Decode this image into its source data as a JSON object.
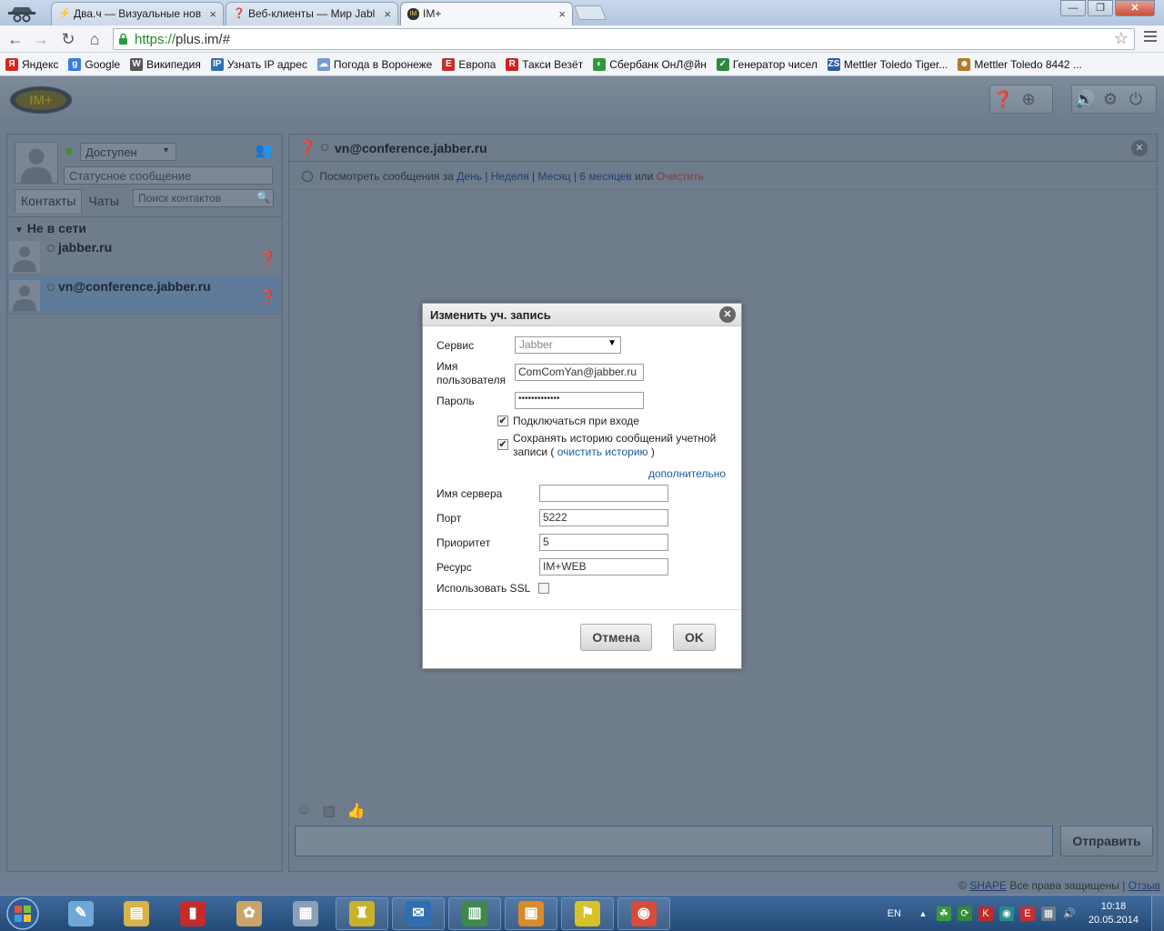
{
  "browser": {
    "tabs": [
      {
        "title": "Два.ч — Визуальные нов",
        "icon": "bolt-icon"
      },
      {
        "title": "Веб-клиенты — Мир Jabl",
        "icon": "jabber-bulb-icon"
      },
      {
        "title": "IM+",
        "icon": "implus-icon"
      }
    ],
    "tab_close": "×",
    "window_buttons": {
      "minimize": "—",
      "maximize": "❐",
      "close": "✕"
    },
    "nav": {
      "back": "←",
      "forward": "→",
      "reload": "↻",
      "home": "⌂"
    },
    "url_scheme": "https://",
    "url_rest": "plus.im/#",
    "star": "☆",
    "bookmarks": [
      {
        "label": "Яндекс",
        "icon": "Я",
        "color": "#d9261c"
      },
      {
        "label": "Google",
        "icon": "g",
        "color": "#3a7be0"
      },
      {
        "label": "Википедия",
        "icon": "W",
        "color": "#555555"
      },
      {
        "label": "Узнать IP адрес",
        "icon": "IP",
        "color": "#2f6fb5"
      },
      {
        "label": "Погода в Воронеже",
        "icon": "☁",
        "color": "#7a9ccc"
      },
      {
        "label": "Европа",
        "icon": "E",
        "color": "#c4302b"
      },
      {
        "label": "Такси Везёт",
        "icon": "R",
        "color": "#d32020"
      },
      {
        "label": "Сбербанк ОнЛ@йн",
        "icon": "◐",
        "color": "#2f9a3b"
      },
      {
        "label": "Генератор чисел",
        "icon": "✓",
        "color": "#2b8a3e"
      },
      {
        "label": "Mettler Toledo Tiger...",
        "icon": "ZS",
        "color": "#2d5fa8"
      },
      {
        "label": "Mettler Toledo 8442 ...",
        "icon": "☻",
        "color": "#b07b2a"
      }
    ]
  },
  "app": {
    "logo_text": "IM+",
    "status": "Доступен",
    "status_message_placeholder": "Статусное сообщение",
    "tabs": [
      "Контакты",
      "Чаты"
    ],
    "contact_search_placeholder": "Поиск контактов",
    "group": "Не в сети",
    "contacts": [
      {
        "name": "jabber.ru"
      },
      {
        "name": "vn@conference.jabber.ru"
      }
    ],
    "chat": {
      "title": "vn@conference.jabber.ru",
      "history_prefix": "Посмотреть сообщения за",
      "history_day": "День",
      "history_week": "Неделя",
      "history_month": "Месяц",
      "history_6months": "6 месяцев",
      "history_or": "или",
      "history_clear": "Очистить",
      "send": "Отправить"
    },
    "footer": {
      "copyright": "©",
      "brand": "SHAPE",
      "rights": "Все права защищены",
      "separator": "|",
      "feedback": "Отзыв"
    }
  },
  "dialog": {
    "title": "Изменить уч. запись",
    "service_label": "Сервис",
    "service_value": "Jabber",
    "username_label_1": "Имя",
    "username_label_2": "пользователя",
    "username_value": "ComComYan@jabber.ru",
    "password_label": "Пароль",
    "password_value": "•••••••••••••",
    "auto_connect_label": "Подключаться при входе",
    "auto_connect_checked": true,
    "save_history_line1": "Сохранять историю сообщений учетной",
    "save_history_line2_pre": "записи (",
    "save_history_link": "очистить историю",
    "save_history_line2_post": ")",
    "save_history_checked": true,
    "advanced_link": "дополнительно",
    "server_label": "Имя сервера",
    "server_value": "",
    "port_label": "Порт",
    "port_value": "5222",
    "priority_label": "Приоритет",
    "priority_value": "5",
    "resource_label": "Ресурс",
    "resource_value": "IM+WEB",
    "ssl_label": "Использовать SSL",
    "ssl_checked": false,
    "cancel_label": "Отмена",
    "ok_label": "OK"
  },
  "taskbar": {
    "lang": "EN",
    "time": "10:18",
    "date": "20.05.2014",
    "items": [
      {
        "name": "notes-icon",
        "glyph": "✎",
        "color": "#6fa8d6",
        "pinned": false
      },
      {
        "name": "explorer-icon",
        "glyph": "▤",
        "color": "#d8b24a",
        "pinned": false
      },
      {
        "name": "document-viewer-icon",
        "glyph": "▮",
        "color": "#c42b2b",
        "pinned": false
      },
      {
        "name": "paint-icon",
        "glyph": "✿",
        "color": "#c9a46a",
        "pinned": false
      },
      {
        "name": "calculator-icon",
        "glyph": "▦",
        "color": "#8aa0b8",
        "pinned": false
      },
      {
        "name": "bot-app-icon",
        "glyph": "♜",
        "color": "#c8b22a",
        "pinned": true
      },
      {
        "name": "thunderbird-icon",
        "glyph": "✉",
        "color": "#2f6fb0",
        "pinned": true
      },
      {
        "name": "spreadsheet-icon",
        "glyph": "▥",
        "color": "#3f8a4a",
        "pinned": true
      },
      {
        "name": "presentation-icon",
        "glyph": "▣",
        "color": "#d98a2a",
        "pinned": true
      },
      {
        "name": "flag-app-icon",
        "glyph": "⚑",
        "color": "#d9c12a",
        "pinned": true
      },
      {
        "name": "chrome-icon",
        "glyph": "◉",
        "color": "#d94a3a",
        "pinned": true
      }
    ]
  }
}
